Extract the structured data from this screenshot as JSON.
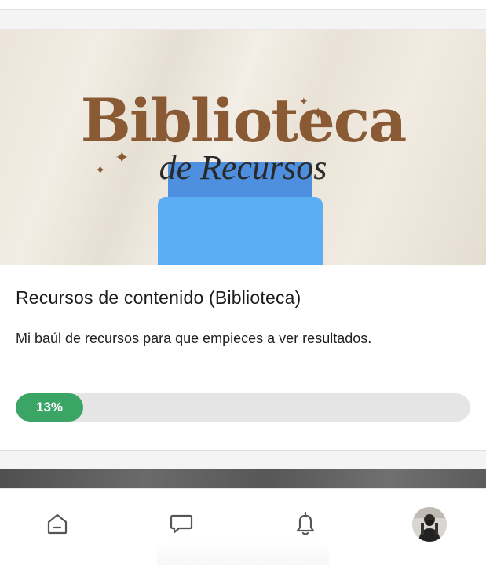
{
  "course": {
    "cover_title": "Biblioteca",
    "cover_subtitle": "de Recursos",
    "title": "Recursos de contenido (Biblioteca)",
    "description": "Mi baúl de recursos para que empieces a ver resultados.",
    "progress_value": 13,
    "progress_label": "13%"
  },
  "nav": {
    "items": [
      {
        "icon": "home-icon"
      },
      {
        "icon": "chat-icon"
      },
      {
        "icon": "bell-icon"
      },
      {
        "icon": "avatar"
      }
    ]
  },
  "colors": {
    "accent_green": "#3aa564",
    "title_brown": "#8a5a34",
    "blob_blue": "#5baef4",
    "icon_gray": "#555555"
  }
}
